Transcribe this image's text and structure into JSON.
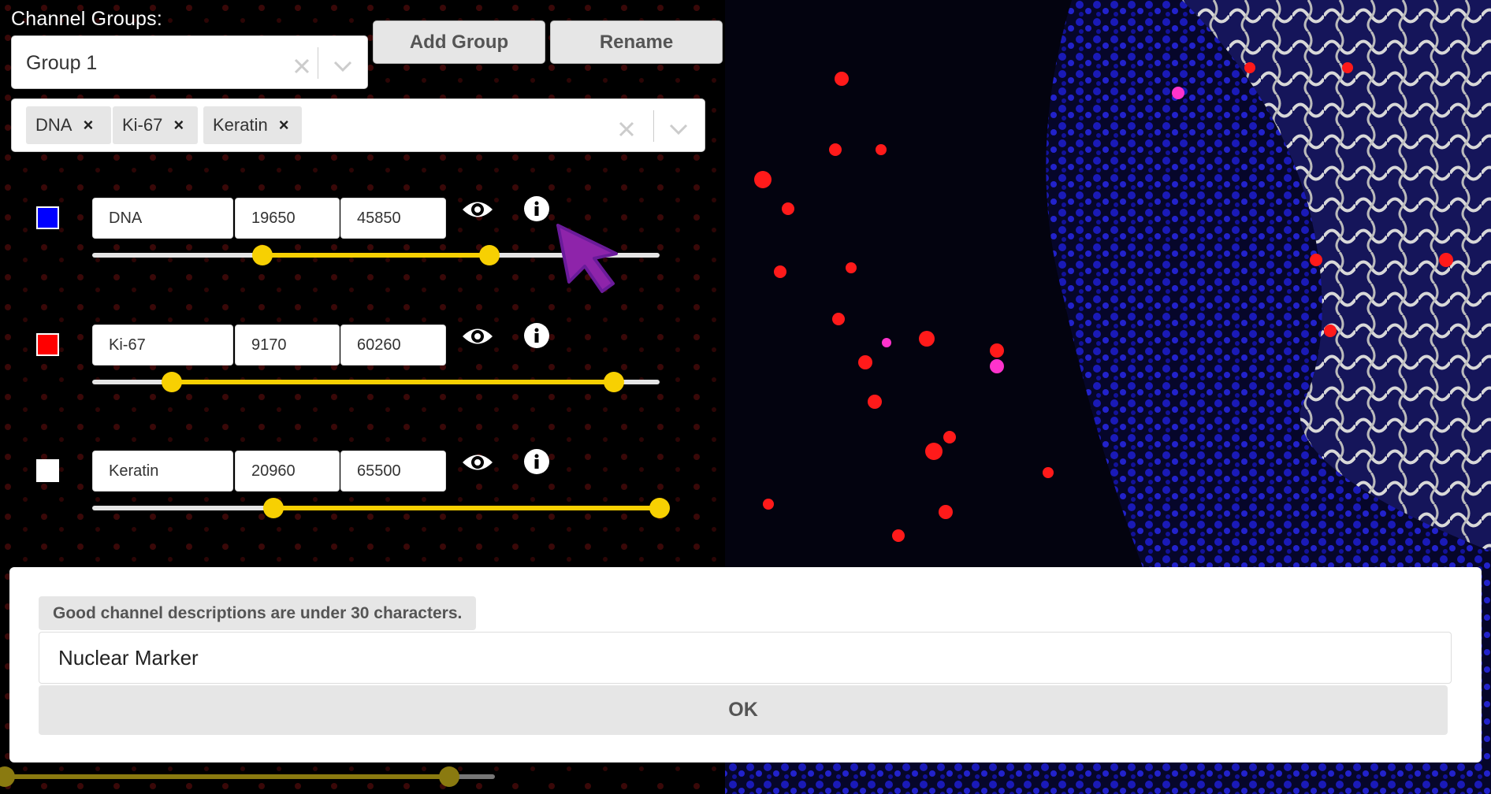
{
  "sidebar": {
    "heading": "Channel Groups:",
    "group_select": {
      "value": "Group 1"
    },
    "add_group_label": "Add Group",
    "rename_label": "Rename",
    "channel_tags": [
      "DNA",
      "Ki-67",
      "Keratin"
    ],
    "channels": [
      {
        "name": "DNA",
        "min": "19650",
        "max": "45850",
        "color": "#0000ff",
        "range_low_fraction": 0.3,
        "range_high_fraction": 0.7
      },
      {
        "name": "Ki-67",
        "min": "9170",
        "max": "60260",
        "color": "#ff0000",
        "range_low_fraction": 0.14,
        "range_high_fraction": 0.92
      },
      {
        "name": "Keratin",
        "min": "20960",
        "max": "65500",
        "color": "#ffffff",
        "range_low_fraction": 0.32,
        "range_high_fraction": 1.0
      }
    ]
  },
  "modal": {
    "hint": "Good channel descriptions are under 30 characters.",
    "description_value": "Nuclear Marker",
    "ok_label": "OK"
  },
  "colors": {
    "accent": "#f7d002",
    "cursor": "#8e24aa"
  }
}
